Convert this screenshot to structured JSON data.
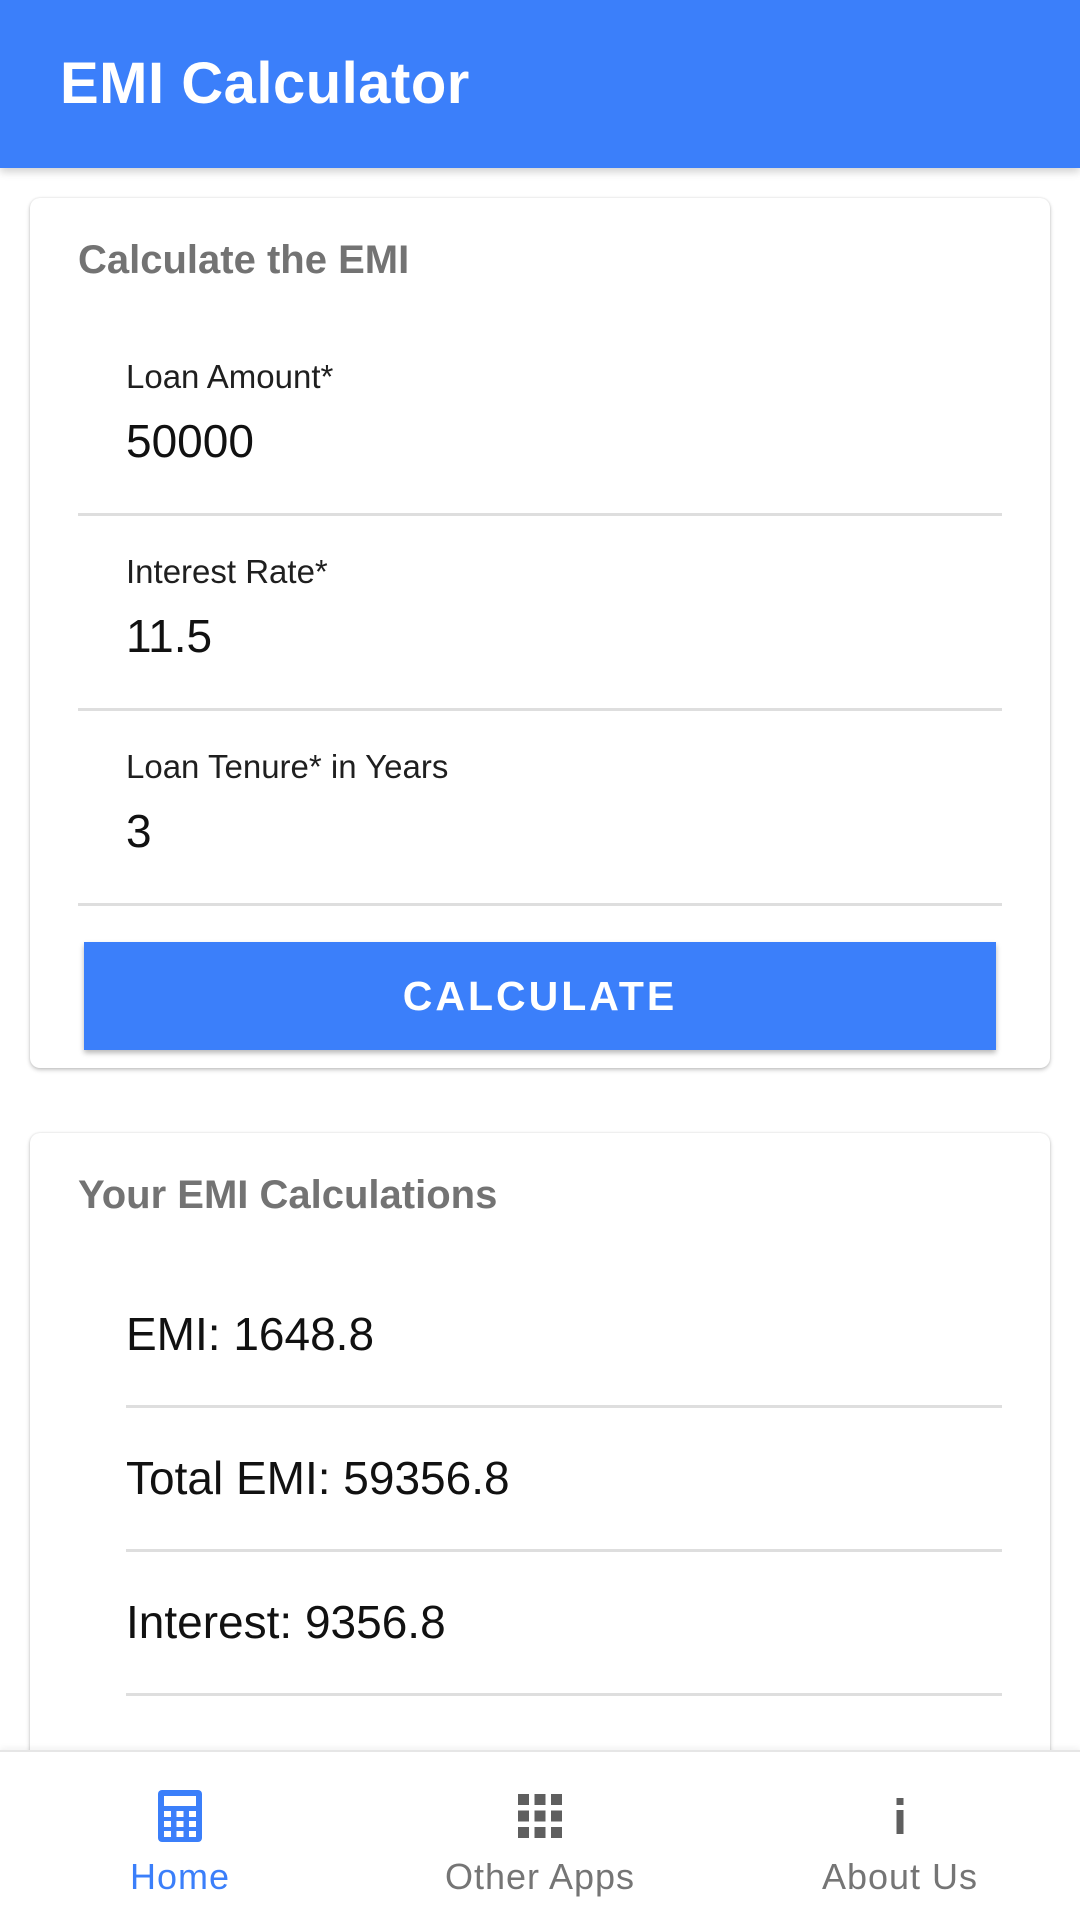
{
  "app": {
    "title": "EMI Calculator",
    "accent_color": "#3b7ffa"
  },
  "input_card": {
    "title": "Calculate the EMI",
    "fields": [
      {
        "label": "Loan Amount*",
        "value": "50000"
      },
      {
        "label": "Interest Rate*",
        "value": "11.5"
      },
      {
        "label": "Loan Tenure* in Years",
        "value": "3"
      }
    ],
    "button_label": "CALCULATE"
  },
  "result_card": {
    "title": "Your EMI Calculations",
    "rows": [
      {
        "text": "EMI: 1648.8"
      },
      {
        "text": "Total EMI: 59356.8"
      },
      {
        "text": "Interest: 9356.8"
      }
    ]
  },
  "bottom_nav": {
    "items": [
      {
        "label": "Home",
        "icon": "calculator-icon",
        "active": true
      },
      {
        "label": "Other Apps",
        "icon": "grid-icon",
        "active": false
      },
      {
        "label": "About Us",
        "icon": "info-icon",
        "active": false
      }
    ]
  }
}
